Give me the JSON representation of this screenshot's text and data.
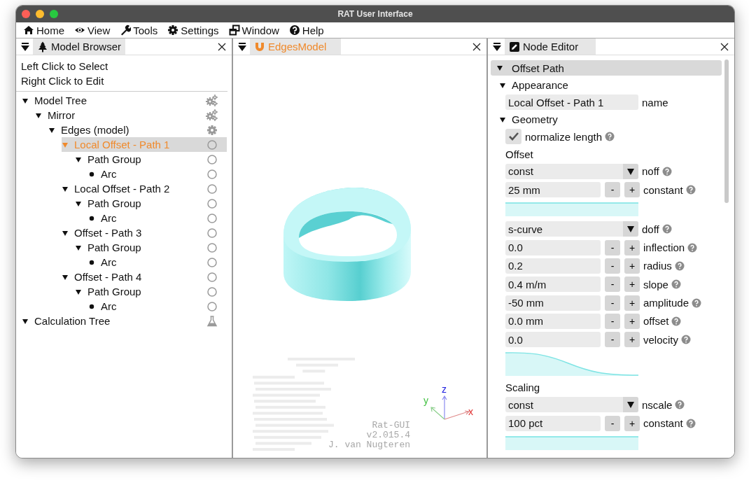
{
  "window": {
    "title": "RAT User Interface"
  },
  "menu": [
    {
      "label": "Home"
    },
    {
      "label": "View"
    },
    {
      "label": "Tools"
    },
    {
      "label": "Settings"
    },
    {
      "label": "Window"
    },
    {
      "label": "Help"
    }
  ],
  "model_browser": {
    "tab": {
      "label": "Model Browser",
      "highlighted": false
    },
    "hints": [
      "Left Click to Select",
      "Right Click to Edit"
    ],
    "tree": [
      {
        "label": "Model Tree",
        "kind": "assembly",
        "expanded": true,
        "selected": false,
        "children": [
          {
            "label": "Mirror",
            "kind": "assembly",
            "expanded": true,
            "selected": false,
            "children": [
              {
                "label": "Edges (model)",
                "kind": "model",
                "expanded": true,
                "selected": false,
                "children": [
                  {
                    "label": "Local Offset - Path 1",
                    "kind": "node",
                    "expanded": true,
                    "selected": true,
                    "children": [
                      {
                        "label": "Path Group",
                        "kind": "node",
                        "expanded": true,
                        "selected": false,
                        "children": [
                          {
                            "label": "Arc",
                            "kind": "node",
                            "expanded": false,
                            "selected": false
                          }
                        ]
                      }
                    ]
                  },
                  {
                    "label": "Local Offset - Path 2",
                    "kind": "node",
                    "expanded": true,
                    "selected": false,
                    "children": [
                      {
                        "label": "Path Group",
                        "kind": "node",
                        "expanded": true,
                        "selected": false,
                        "children": [
                          {
                            "label": "Arc",
                            "kind": "node",
                            "expanded": false,
                            "selected": false
                          }
                        ]
                      }
                    ]
                  },
                  {
                    "label": "Offset - Path 3",
                    "kind": "node",
                    "expanded": true,
                    "selected": false,
                    "children": [
                      {
                        "label": "Path Group",
                        "kind": "node",
                        "expanded": true,
                        "selected": false,
                        "children": [
                          {
                            "label": "Arc",
                            "kind": "node",
                            "expanded": false,
                            "selected": false
                          }
                        ]
                      }
                    ]
                  },
                  {
                    "label": "Offset - Path 4",
                    "kind": "node",
                    "expanded": true,
                    "selected": false,
                    "children": [
                      {
                        "label": "Path Group",
                        "kind": "node",
                        "expanded": true,
                        "selected": false,
                        "children": [
                          {
                            "label": "Arc",
                            "kind": "node",
                            "expanded": false,
                            "selected": false
                          }
                        ]
                      }
                    ]
                  }
                ]
              }
            ]
          }
        ]
      },
      {
        "label": "Calculation Tree",
        "kind": "calculation",
        "expanded": true,
        "selected": false
      }
    ]
  },
  "viewport": {
    "tab": {
      "label": "EdgesModel",
      "highlighted": true
    },
    "axes": {
      "x": "x",
      "y": "y",
      "z": "z"
    },
    "credits": [
      "Rat-GUI",
      "v2.015.4",
      "J. van Nugteren"
    ]
  },
  "node_editor": {
    "tab": {
      "label": "Node Editor",
      "highlighted": false
    },
    "sections": [
      {
        "title": "Offset Path",
        "expanded": true,
        "groups": [
          {
            "title": "Appearance",
            "expanded": true,
            "items": [
              {
                "kind": "text",
                "value": "Local Offset - Path 1",
                "label": "name"
              }
            ]
          },
          {
            "title": "Geometry",
            "expanded": true,
            "items": [
              {
                "kind": "checkbox",
                "label": "normalize length",
                "checked": true,
                "help": true
              },
              {
                "kind": "subsection",
                "title": "Offset",
                "items": [
                  {
                    "kind": "dropdown",
                    "value": "const",
                    "label": "noff",
                    "help": true
                  },
                  {
                    "kind": "number",
                    "value": "25 mm",
                    "label": "constant",
                    "help": true
                  },
                  {
                    "kind": "band"
                  },
                  {
                    "kind": "dropdown",
                    "value": "s-curve",
                    "label": "doff",
                    "help": true
                  },
                  {
                    "kind": "number",
                    "value": "0.0",
                    "label": "inflection",
                    "help": true
                  },
                  {
                    "kind": "number",
                    "value": "0.2",
                    "label": "radius",
                    "help": true
                  },
                  {
                    "kind": "number",
                    "value": "0.4 m/m",
                    "label": "slope",
                    "help": true
                  },
                  {
                    "kind": "number",
                    "value": "-50 mm",
                    "label": "amplitude",
                    "help": true
                  },
                  {
                    "kind": "number",
                    "value": "0.0 mm",
                    "label": "offset",
                    "help": true
                  },
                  {
                    "kind": "number",
                    "value": "0.0",
                    "label": "velocity",
                    "help": true
                  },
                  {
                    "kind": "curve"
                  }
                ]
              },
              {
                "kind": "subsection",
                "title": "Scaling",
                "items": [
                  {
                    "kind": "dropdown",
                    "value": "const",
                    "label": "nscale",
                    "help": true
                  },
                  {
                    "kind": "number",
                    "value": "100 pct",
                    "label": "constant",
                    "help": true
                  },
                  {
                    "kind": "band"
                  }
                ]
              }
            ]
          }
        ]
      }
    ],
    "minus": "-",
    "plus": "+"
  }
}
